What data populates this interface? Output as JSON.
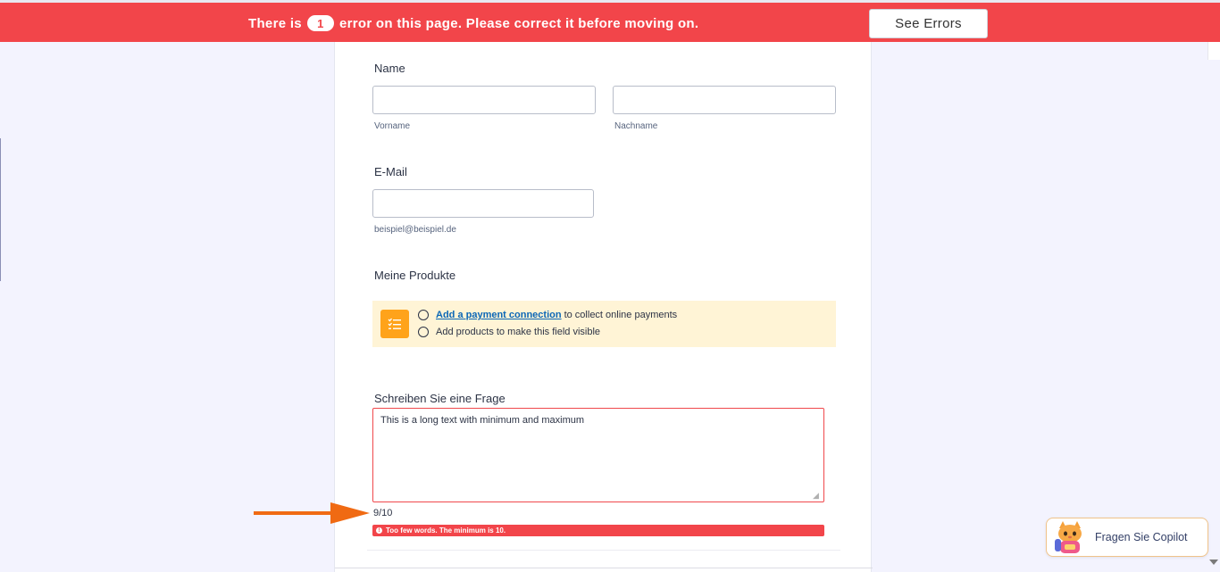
{
  "error_banner": {
    "text_before": "There is",
    "error_count": "1",
    "text_after": "error on this page. Please correct it before moving on.",
    "button_label": "See Errors",
    "color": "#f2454a"
  },
  "form": {
    "name": {
      "label": "Name",
      "first": {
        "value": "",
        "sublabel": "Vorname"
      },
      "last": {
        "value": "",
        "sublabel": "Nachname"
      }
    },
    "email": {
      "label": "E-Mail",
      "value": "",
      "sublabel": "beispiel@beispiel.de"
    },
    "products": {
      "label": "Meine Produkte",
      "icon": "list-icon",
      "line1_link": "Add a payment connection",
      "line1_rest": "to collect online payments",
      "line2": "Add products to make this field visible"
    },
    "question": {
      "label": "Schreiben Sie eine Frage",
      "value": "This is a long text with minimum and maximum",
      "word_count": "9/10",
      "error": "Too few words. The minimum is 10."
    }
  },
  "copilot": {
    "label": "Fragen Sie Copilot"
  }
}
